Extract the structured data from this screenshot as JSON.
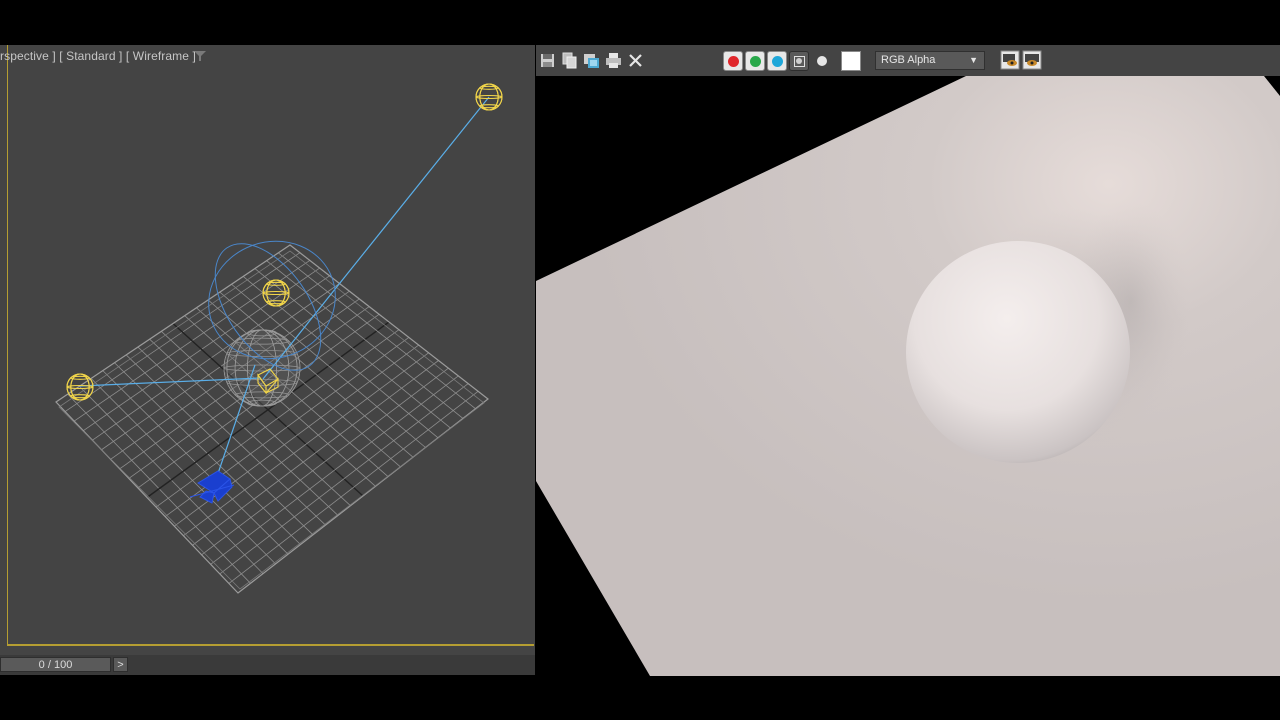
{
  "viewport": {
    "label_parts": [
      "rspective ]",
      "[ Standard ]",
      "[ Wireframe ]"
    ],
    "icons": {
      "filter": "filter-icon"
    },
    "colors": {
      "background": "#444444",
      "active_border": "#b59e32",
      "grid": "#8a8a8a",
      "light_helper": "#f0d44a",
      "target_line": "#5aaee8",
      "camera": "#1a3fcf"
    }
  },
  "timeline": {
    "frame_display": "0 / 100",
    "next_label": ">"
  },
  "render_frame": {
    "toolbar": {
      "icons": [
        "save-image-icon",
        "copy-image-icon",
        "clone-frame-icon",
        "print-icon",
        "clear-icon"
      ],
      "channels": [
        {
          "name": "red-channel-button",
          "color": "#e0262b"
        },
        {
          "name": "green-channel-button",
          "color": "#29a84a"
        },
        {
          "name": "blue-channel-button",
          "color": "#1fa7d9"
        }
      ],
      "channel_select": "RGB Alpha"
    },
    "colors": {
      "plane": "#cfc8c6",
      "sphere_highlight": "#f3eeed",
      "background": "#000000"
    }
  }
}
